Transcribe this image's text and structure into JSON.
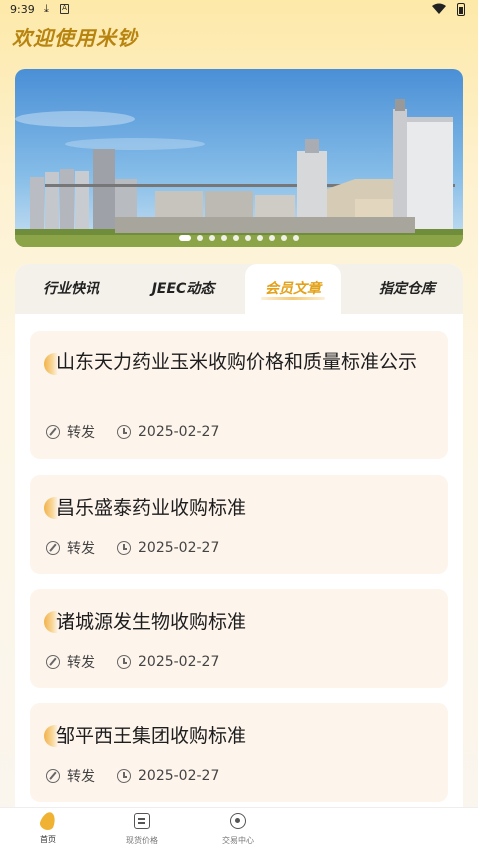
{
  "status_bar": {
    "time": "9:39",
    "download_glyph": "⤓",
    "a_glyph": "A"
  },
  "welcome": "欢迎使用米钞",
  "banner": {
    "slide_count": 10,
    "active_index": 0,
    "image": "grain-silo-factory"
  },
  "tabs": [
    {
      "label": "行业快讯",
      "active": false
    },
    {
      "label": "JEEC动态",
      "active": false
    },
    {
      "label": "会员文章",
      "active": true
    },
    {
      "label": "指定仓库",
      "active": false
    }
  ],
  "articles": [
    {
      "title": "山东天力药业玉米收购价格和质量标准公示",
      "action": "转发",
      "date": "2025-02-27"
    },
    {
      "title": "昌乐盛泰药业收购标准",
      "action": "转发",
      "date": "2025-02-27"
    },
    {
      "title": "诸城源发生物收购标准",
      "action": "转发",
      "date": "2025-02-27"
    },
    {
      "title": "邹平西王集团收购标准",
      "action": "转发",
      "date": "2025-02-27"
    }
  ],
  "bottom_nav": [
    {
      "label": "首页",
      "icon": "corn-icon",
      "active": true
    },
    {
      "label": "现货价格",
      "icon": "price-list-icon",
      "active": false
    },
    {
      "label": "交易中心",
      "icon": "trade-center-icon",
      "active": false
    }
  ],
  "colors": {
    "accent": "#e3a21a",
    "welcome": "#b88410",
    "card_bg": "#fdf4ec"
  }
}
